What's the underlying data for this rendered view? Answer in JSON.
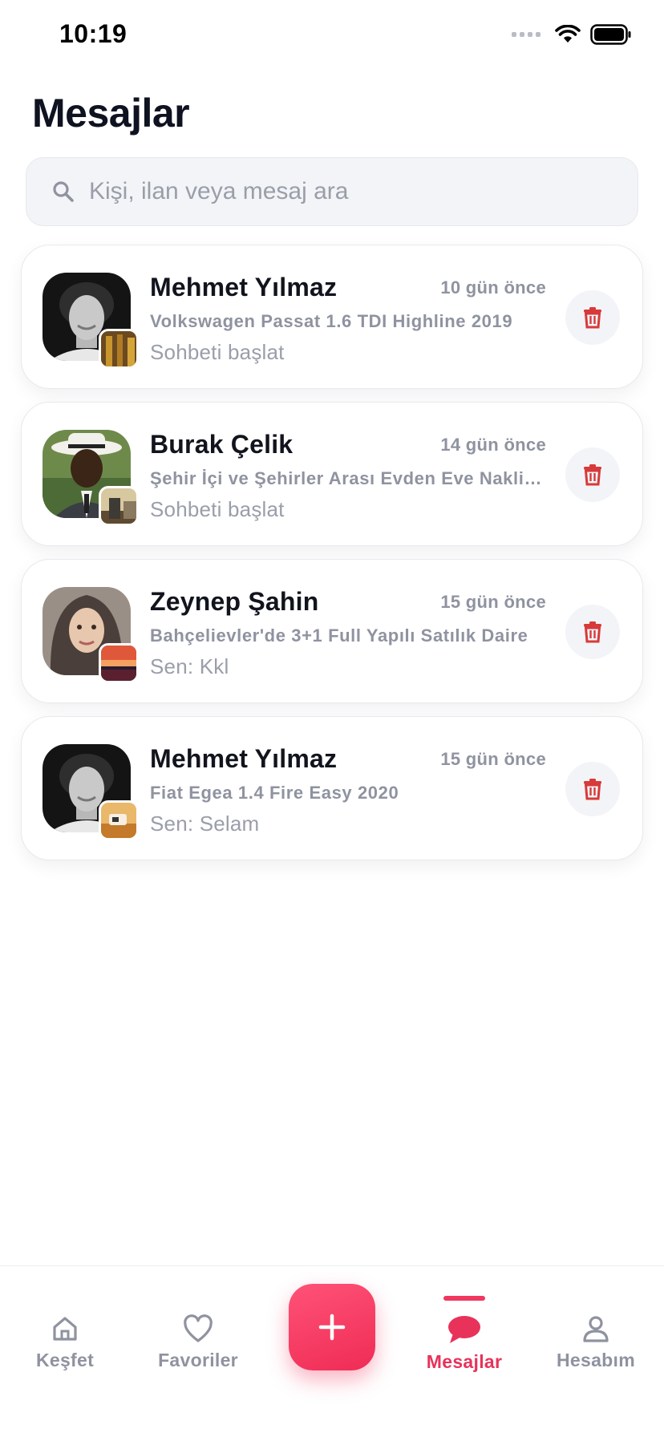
{
  "status_bar": {
    "time": "10:19"
  },
  "page": {
    "title": "Mesajlar"
  },
  "search": {
    "placeholder": "Kişi, ilan veya mesaj ara"
  },
  "conversations": [
    {
      "name": "Mehmet Yılmaz",
      "time": "10 gün önce",
      "listing": "Volkswagen Passat 1.6 TDI Highline 2019",
      "preview": "Sohbeti başlat"
    },
    {
      "name": "Burak Çelik",
      "time": "14 gün önce",
      "listing": "Şehir İçi ve Şehirler Arası Evden Eve Nakliyat",
      "preview": "Sohbeti başlat"
    },
    {
      "name": "Zeynep Şahin",
      "time": "15 gün önce",
      "listing": "Bahçelievler'de 3+1 Full Yapılı Satılık Daire",
      "preview": "Sen: Kkl"
    },
    {
      "name": "Mehmet Yılmaz",
      "time": "15 gün önce",
      "listing": "Fiat Egea 1.4 Fire Easy 2020",
      "preview": "Sen: Selam"
    }
  ],
  "tabs": [
    {
      "label": "Keşfet",
      "icon": "home-icon"
    },
    {
      "label": "Favoriler",
      "icon": "heart-icon"
    },
    {
      "label": "",
      "icon": "plus-icon"
    },
    {
      "label": "Mesajlar",
      "icon": "chat-bubble-icon",
      "active": true
    },
    {
      "label": "Hesabım",
      "icon": "user-icon"
    }
  ],
  "colors": {
    "accent": "#f0375e",
    "delete": "#d83a3a",
    "muted_text": "#8f93a0",
    "search_bg": "#f3f4f7"
  }
}
